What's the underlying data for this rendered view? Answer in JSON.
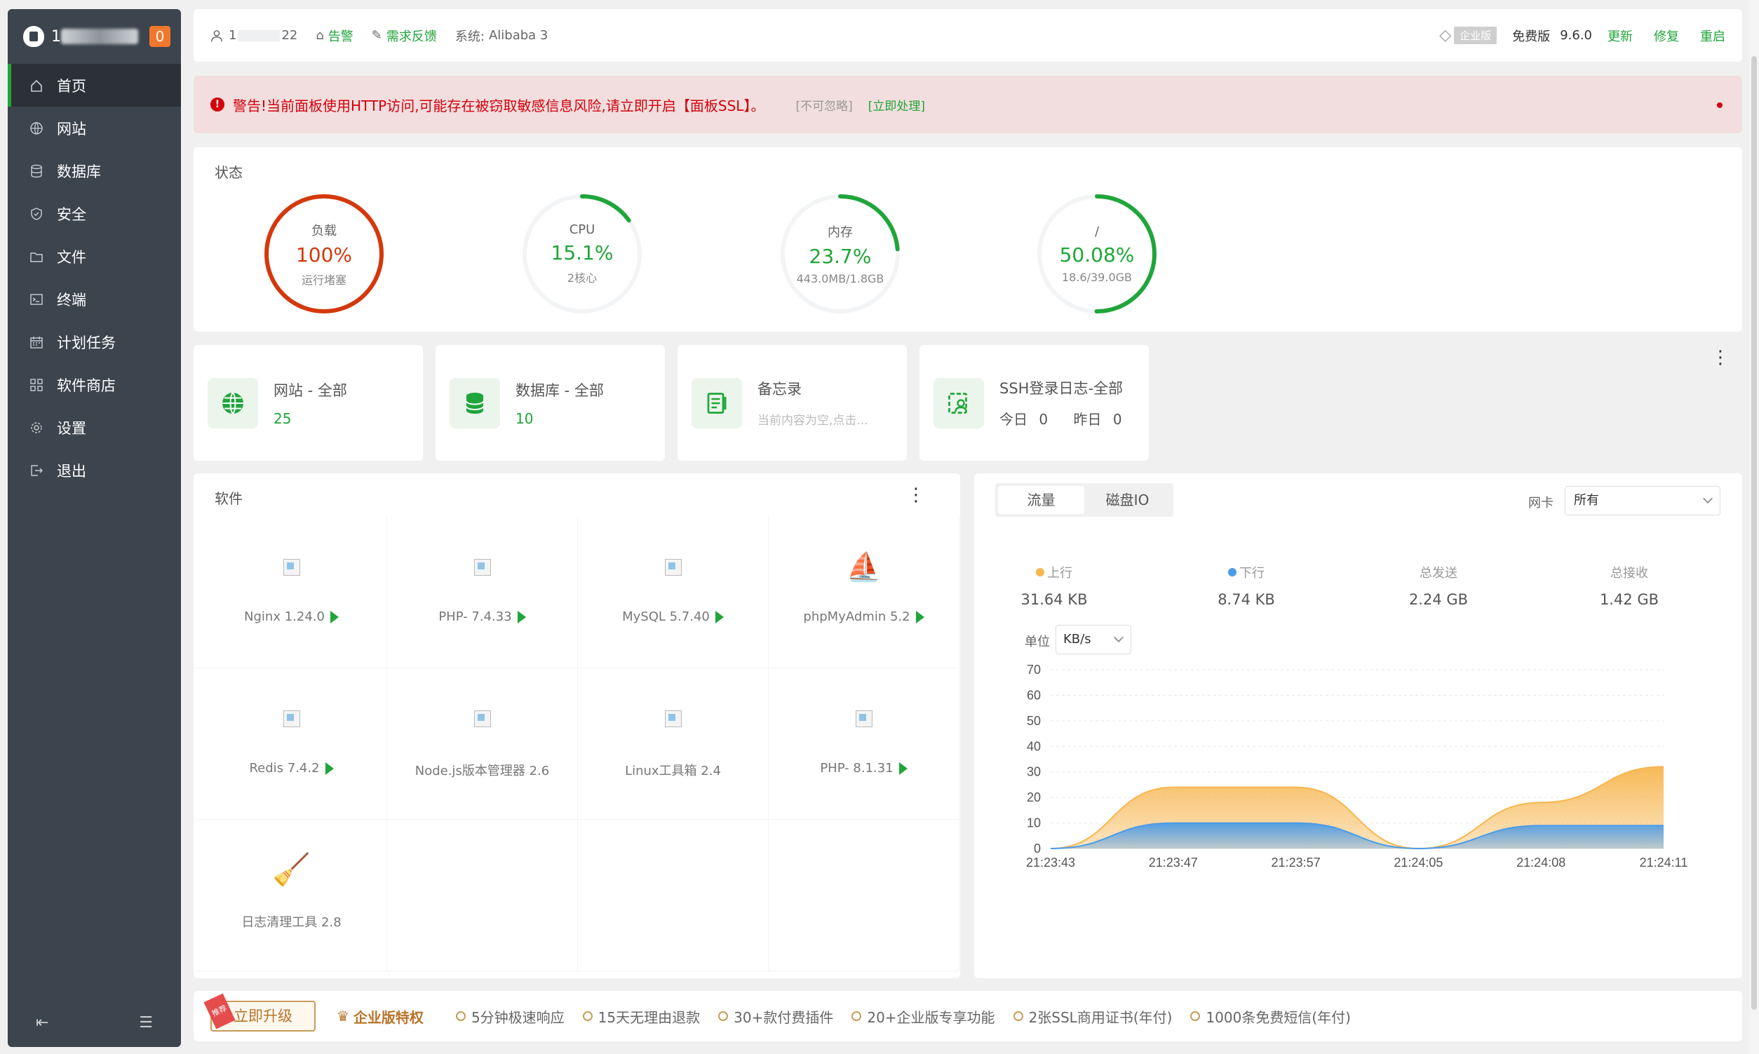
{
  "sidebar": {
    "badge": "0",
    "items": [
      {
        "label": "首页",
        "icon": "home-icon"
      },
      {
        "label": "网站",
        "icon": "globe-icon"
      },
      {
        "label": "数据库",
        "icon": "database-icon"
      },
      {
        "label": "安全",
        "icon": "shield-icon"
      },
      {
        "label": "文件",
        "icon": "folder-icon"
      },
      {
        "label": "终端",
        "icon": "terminal-icon"
      },
      {
        "label": "计划任务",
        "icon": "calendar-icon"
      },
      {
        "label": "软件商店",
        "icon": "grid-icon"
      },
      {
        "label": "设置",
        "icon": "gear-icon"
      },
      {
        "label": "退出",
        "icon": "logout-icon"
      }
    ]
  },
  "topbar": {
    "user_prefix": "1",
    "user_suffix": "22",
    "alerts_label": "告警",
    "feedback_label": "需求反馈",
    "system_label": "系统:",
    "system_value": "Alibaba 3",
    "enterprise_badge": "企业版",
    "edition": "免费版",
    "version": "9.6.0",
    "update": "更新",
    "repair": "修复",
    "restart": "重启"
  },
  "alert": {
    "icon": "!",
    "message": "警告!当前面板使用HTTP访问,可能存在被窃取敏感信息风险,请立即开启【面板SSL】。",
    "ignore": "[不可忽略]",
    "action": "[立即处理]"
  },
  "status": {
    "title": "状态",
    "gauges": [
      {
        "label": "负载",
        "value": "100%",
        "sub": "运行堵塞",
        "percent": 100,
        "color": "#d4380d"
      },
      {
        "label": "CPU",
        "value": "15.1%",
        "sub": "2核心",
        "percent": 15.1,
        "color": "#20a53a"
      },
      {
        "label": "内存",
        "value": "23.7%",
        "sub": "443.0MB/1.8GB",
        "percent": 23.7,
        "color": "#20a53a"
      },
      {
        "label": "/",
        "value": "50.08%",
        "sub": "18.6/39.0GB",
        "percent": 50.08,
        "color": "#20a53a"
      }
    ]
  },
  "quick": {
    "site": {
      "title": "网站 - 全部",
      "value": "25"
    },
    "db": {
      "title": "数据库 - 全部",
      "value": "10"
    },
    "memo": {
      "title": "备忘录",
      "sub": "当前内容为空,点击..."
    },
    "ssh": {
      "title": "SSH登录日志-全部",
      "today_label": "今日",
      "today": "0",
      "yesterday_label": "昨日",
      "yesterday": "0"
    }
  },
  "software": {
    "title": "软件",
    "items": [
      {
        "name": "Nginx 1.24.0",
        "play": true
      },
      {
        "name": "PHP- 7.4.33",
        "play": true
      },
      {
        "name": "MySQL 5.7.40",
        "play": true
      },
      {
        "name": "phpMyAdmin 5.2",
        "play": true
      },
      {
        "name": "Redis 7.4.2",
        "play": true
      },
      {
        "name": "Node.js版本管理器 2.6",
        "play": false
      },
      {
        "name": "Linux工具箱 2.4",
        "play": false
      },
      {
        "name": "PHP- 8.1.31",
        "play": true
      },
      {
        "name": "日志清理工具 2.8",
        "play": false
      }
    ]
  },
  "traffic": {
    "tabs": [
      "流量",
      "磁盘IO"
    ],
    "nic_label": "网卡",
    "nic_value": "所有",
    "stats": [
      {
        "label": "上行",
        "value": "31.64 KB",
        "color": "#f7b64f"
      },
      {
        "label": "下行",
        "value": "8.74 KB",
        "color": "#4b9be8"
      },
      {
        "label": "总发送",
        "value": "2.24 GB"
      },
      {
        "label": "总接收",
        "value": "1.42 GB"
      }
    ],
    "unit_label": "单位",
    "unit_value": "KB/s"
  },
  "chart_data": {
    "type": "area",
    "x": [
      "21:23:43",
      "21:23:47",
      "21:23:57",
      "21:24:05",
      "21:24:08",
      "21:24:11"
    ],
    "ylim": [
      0,
      70
    ],
    "yticks": [
      0,
      10,
      20,
      30,
      40,
      50,
      60,
      70
    ],
    "series": [
      {
        "name": "上行",
        "values": [
          0,
          24,
          24,
          0,
          18,
          32
        ],
        "color": "#f7b64f"
      },
      {
        "name": "下行",
        "values": [
          0,
          10,
          10,
          0,
          9,
          9
        ],
        "color": "#4b9be8"
      }
    ]
  },
  "bottombar": {
    "upgrade": "立即升级",
    "tag": "推荐",
    "enterprise_title": "企业版特权",
    "features": [
      "5分钟极速响应",
      "15天无理由退款",
      "30+款付费插件",
      "20+企业版专享功能",
      "2张SSL商用证书(年付)",
      "1000条免费短信(年付)"
    ]
  }
}
